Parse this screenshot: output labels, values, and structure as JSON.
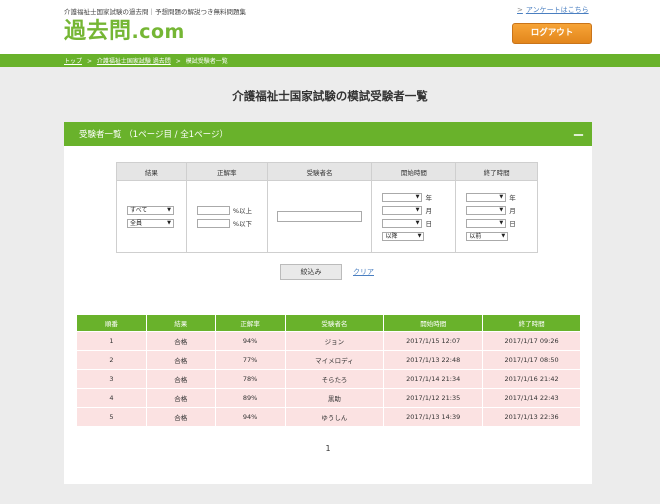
{
  "header": {
    "tagline": "介護福祉士国家試験の過去問｜予想問題の解説つき無料問題集",
    "logo_main": "過去問",
    "logo_domain": ".com",
    "survey_link": "アンケートはこちら",
    "logout_label": "ログアウト"
  },
  "breadcrumb": {
    "items": [
      "トップ",
      "介護福祉士国家試験 過去問",
      "模試受験者一覧"
    ],
    "separator": ">"
  },
  "page_title": "介護福祉士国家試験の模試受験者一覧",
  "panel": {
    "title": "受験者一覧 （1ページ目 / 全1ページ）",
    "collapse_symbol": "ー"
  },
  "filter": {
    "headers": [
      "結果",
      "正解率",
      "受験者名",
      "開始時間",
      "終了時間"
    ],
    "result_select": "すべて",
    "member_select": "全員",
    "rate_min_suffix": "%以上",
    "rate_max_suffix": "%以下",
    "name_value": "",
    "date_units": [
      "年",
      "月",
      "日"
    ],
    "start_mode": "以降",
    "end_mode": "以前",
    "submit_label": "絞込み",
    "clear_label": "クリア"
  },
  "results": {
    "headers": [
      "順番",
      "結果",
      "正解率",
      "受験者名",
      "開始時間",
      "終了時間"
    ],
    "rows": [
      [
        "1",
        "合格",
        "94%",
        "ジョン",
        "2017/1/15 12:07",
        "2017/1/17 09:26"
      ],
      [
        "2",
        "合格",
        "77%",
        "マイメロディ",
        "2017/1/13 22:48",
        "2017/1/17 08:50"
      ],
      [
        "3",
        "合格",
        "78%",
        "そらたろ",
        "2017/1/14 21:34",
        "2017/1/16 21:42"
      ],
      [
        "4",
        "合格",
        "89%",
        "黒助",
        "2017/1/12 21:35",
        "2017/1/14 22:43"
      ],
      [
        "5",
        "合格",
        "94%",
        "ゆうしん",
        "2017/1/13 14:39",
        "2017/1/13 22:36"
      ]
    ]
  },
  "pagination": {
    "current": "1"
  },
  "colors": {
    "brand_green": "#69b22b",
    "logout_orange": "#f39c2c",
    "row_pink": "#fbe2e2",
    "link_blue": "#4a7fc1"
  }
}
